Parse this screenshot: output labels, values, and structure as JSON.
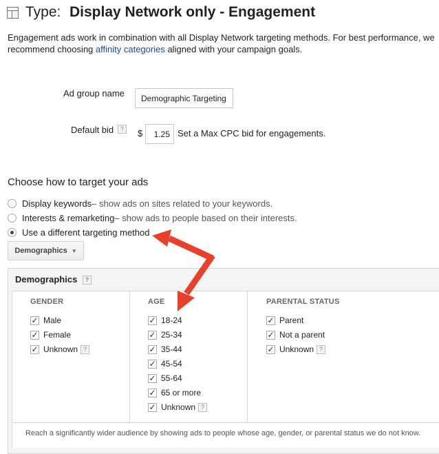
{
  "header": {
    "type_label": "Type:",
    "title": "Display Network only - Engagement"
  },
  "description": {
    "part1": "Engagement ads work in combination with all Display Network targeting methods. For best performance, we recommend choosing ",
    "link": "affinity categories",
    "part2": " aligned with your campaign goals."
  },
  "form": {
    "ad_group_label": "Ad group name",
    "ad_group_value": "Demographic Targeting",
    "default_bid_label": "Default bid",
    "help_glyph": "?",
    "currency": "$",
    "bid_value": "1.25",
    "bid_hint": "Set a Max CPC bid for engagements."
  },
  "targeting": {
    "title": "Choose how to target your ads",
    "options": [
      {
        "label": "Display keywords",
        "desc": " – show ads on sites related to your keywords.",
        "selected": false
      },
      {
        "label": "Interests & remarketing",
        "desc": " – show ads to people based on their interests.",
        "selected": false
      },
      {
        "label": "Use a different targeting method",
        "desc": "",
        "selected": true
      }
    ],
    "method_button": "Demographics",
    "caret": "▼"
  },
  "demographics": {
    "title": "Demographics",
    "check_glyph": "✓",
    "columns": [
      {
        "heading": "GENDER",
        "items": [
          "Male",
          "Female",
          "Unknown"
        ]
      },
      {
        "heading": "AGE",
        "items": [
          "18-24",
          "25-34",
          "35-44",
          "45-54",
          "55-64",
          "65 or more",
          "Unknown"
        ]
      },
      {
        "heading": "PARENTAL STATUS",
        "items": [
          "Parent",
          "Not a parent",
          "Unknown"
        ]
      }
    ],
    "footer": "Reach a significantly wider audience by showing ads to people whose age, gender, or parental status we do not know."
  },
  "colors": {
    "link": "#1a4aa8",
    "arrow": "#e8412b"
  }
}
